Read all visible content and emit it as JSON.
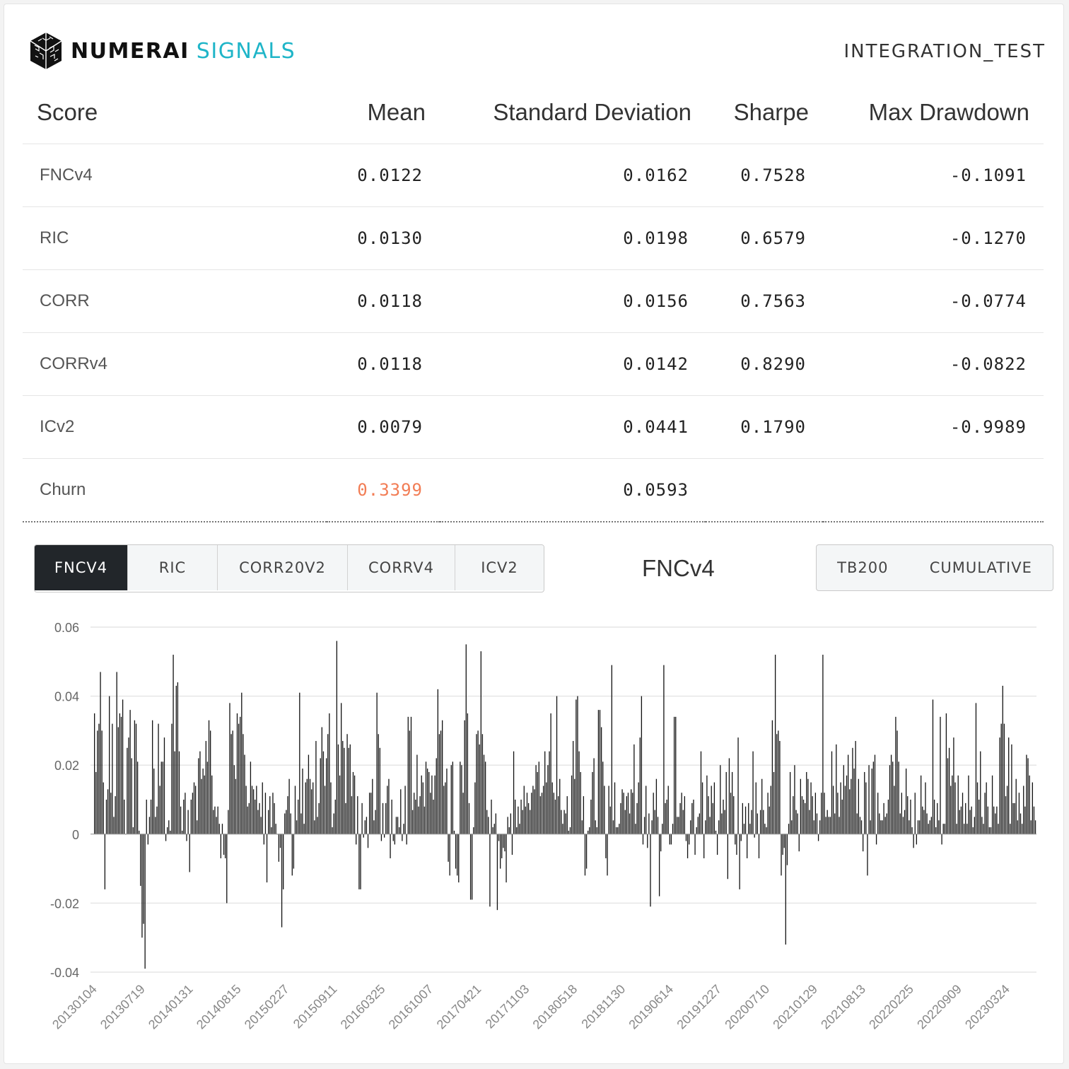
{
  "header": {
    "brand_main": "NUMERAI",
    "brand_sub": "SIGNALS",
    "model_name": "INTEGRATION_TEST"
  },
  "scores_table": {
    "headers": [
      "Score",
      "Mean",
      "Standard Deviation",
      "Sharpe",
      "Max Drawdown"
    ],
    "rows": [
      {
        "name": "FNCv4",
        "mean": "0.0122",
        "std": "0.0162",
        "sharpe": "0.7528",
        "max_drawdown": "-0.1091"
      },
      {
        "name": "RIC",
        "mean": "0.0130",
        "std": "0.0198",
        "sharpe": "0.6579",
        "max_drawdown": "-0.1270"
      },
      {
        "name": "CORR",
        "mean": "0.0118",
        "std": "0.0156",
        "sharpe": "0.7563",
        "max_drawdown": "-0.0774"
      },
      {
        "name": "CORRv4",
        "mean": "0.0118",
        "std": "0.0142",
        "sharpe": "0.8290",
        "max_drawdown": "-0.0822"
      },
      {
        "name": "ICv2",
        "mean": "0.0079",
        "std": "0.0441",
        "sharpe": "0.1790",
        "max_drawdown": "-0.9989"
      },
      {
        "name": "Churn",
        "mean": "0.3399",
        "std": "0.0593",
        "sharpe": "",
        "max_drawdown": ""
      }
    ],
    "highlight_color": "#f27d55"
  },
  "metric_tabs": [
    {
      "label": "FNCV4",
      "active": true
    },
    {
      "label": "RIC",
      "active": false
    },
    {
      "label": "CORR20V2",
      "active": false
    },
    {
      "label": "CORRV4",
      "active": false
    },
    {
      "label": "ICV2",
      "active": false
    }
  ],
  "chart_title": "FNCv4",
  "view_toggles": [
    "TB200",
    "CUMULATIVE"
  ],
  "colors": {
    "accent": "#1fb5c8",
    "active_tab": "#22262a",
    "bar": "#111111",
    "grid": "#e6e6e6"
  },
  "chart_data": {
    "type": "bar",
    "title": "FNCv4",
    "ylim": [
      -0.04,
      0.06
    ],
    "y_ticks": [
      "0.06",
      "0.04",
      "0.02",
      "0",
      "-0.02",
      "-0.04"
    ],
    "y_tick_values": [
      0.06,
      0.04,
      0.02,
      0,
      -0.02,
      -0.04
    ],
    "x_tick_labels": [
      "20130104",
      "20130719",
      "20140131",
      "20140815",
      "20150227",
      "20150911",
      "20160325",
      "20161007",
      "20170421",
      "20171103",
      "20180518",
      "20181130",
      "20190614",
      "20191227",
      "20200710",
      "20210129",
      "20210813",
      "20220225",
      "20220909",
      "20230324"
    ],
    "grid": true,
    "legend": "none",
    "values": [
      0.035,
      0.018,
      0.03,
      0.032,
      0.047,
      0.03,
      0.015,
      -0.016,
      0.01,
      0.013,
      0.04,
      0.012,
      0.032,
      0.005,
      0.011,
      0.047,
      0.031,
      0.035,
      0.034,
      0.039,
      0.01,
      0.0,
      0.025,
      0.028,
      0.036,
      0.022,
      0.002,
      0.033,
      0.032,
      0.021,
      0.001,
      -0.015,
      -0.03,
      -0.026,
      -0.039,
      0.01,
      -0.003,
      0.005,
      0.01,
      0.033,
      0.019,
      0.005,
      0.008,
      0.032,
      0.014,
      0.021,
      0.021,
      0.028,
      -0.002,
      0.002,
      0.004,
      0.001,
      0.032,
      0.052,
      0.024,
      0.043,
      0.044,
      0.024,
      0.008,
      0.001,
      0.01,
      0.012,
      -0.002,
      0.007,
      -0.011,
      0.01,
      0.012,
      0.015,
      0.014,
      0.004,
      0.022,
      0.024,
      0.016,
      0.019,
      0.017,
      0.027,
      0.021,
      0.033,
      0.03,
      0.017,
      0.007,
      0.008,
      0.005,
      0.008,
      0.003,
      -0.007,
      0.003,
      -0.006,
      -0.007,
      -0.02,
      0.007,
      0.038,
      0.029,
      0.03,
      0.02,
      0.016,
      0.035,
      0.032,
      0.034,
      0.041,
      0.029,
      0.023,
      0.014,
      0.008,
      0.009,
      0.021,
      0.014,
      0.013,
      0.01,
      0.014,
      0.007,
      0.009,
      0.005,
      0.015,
      -0.003,
      0.012,
      -0.014,
      0.007,
      0.011,
      0.002,
      0.012,
      0.009,
      0.003,
      0.0,
      -0.008,
      -0.004,
      -0.027,
      -0.016,
      0.006,
      0.007,
      0.011,
      0.016,
      0.006,
      -0.012,
      -0.01,
      0.014,
      0.004,
      0.01,
      0.041,
      0.006,
      0.019,
      0.003,
      0.015,
      0.016,
      0.023,
      0.016,
      0.013,
      0.015,
      0.004,
      0.027,
      0.005,
      0.009,
      0.022,
      0.031,
      0.024,
      0.014,
      0.022,
      0.029,
      0.035,
      0.015,
      0.002,
      0.006,
      0.01,
      0.056,
      0.026,
      0.017,
      0.038,
      0.027,
      0.025,
      0.009,
      0.029,
      0.025,
      0.026,
      0.011,
      0.018,
      0.017,
      -0.003,
      0.011,
      -0.016,
      -0.016,
      0.009,
      -0.001,
      0.004,
      0.005,
      -0.004,
      0.012,
      0.012,
      0.016,
      0.004,
      0.007,
      0.041,
      0.029,
      0.025,
      -0.002,
      0.009,
      -0.001,
      0.009,
      0.014,
      0.016,
      -0.007,
      0.01,
      -0.002,
      -0.003,
      0.005,
      0.005,
      0.002,
      0.013,
      -0.002,
      0.003,
      0.014,
      -0.003,
      0.034,
      0.03,
      0.034,
      0.007,
      0.012,
      0.01,
      0.023,
      0.008,
      0.011,
      0.017,
      0.015,
      0.008,
      0.021,
      0.019,
      0.018,
      0.012,
      0.017,
      0.01,
      0.017,
      0.022,
      0.042,
      0.029,
      0.03,
      0.033,
      0.014,
      0.015,
      0.019,
      -0.008,
      -0.012,
      0.02,
      0.021,
      0.001,
      -0.01,
      -0.012,
      -0.014,
      0.021,
      0.02,
      0.012,
      0.033,
      0.055,
      0.035,
      0.009,
      -0.019,
      -0.019,
      0.002,
      0.015,
      0.029,
      0.03,
      0.026,
      0.053,
      0.029,
      0.023,
      0.021,
      0.007,
      0.005,
      -0.021,
      0.01,
      0.002,
      0.003,
      0.006,
      -0.022,
      -0.002,
      -0.01,
      -0.007,
      -0.004,
      -0.005,
      -0.014,
      0.005,
      0.002,
      0.006,
      -0.006,
      0.024,
      0.01,
      0.002,
      0.008,
      0.003,
      0.01,
      0.007,
      0.014,
      0.008,
      0.012,
      0.009,
      0.007,
      0.012,
      0.014,
      0.013,
      0.02,
      0.018,
      0.021,
      0.011,
      0.012,
      0.014,
      0.024,
      0.015,
      0.02,
      0.024,
      0.035,
      0.015,
      0.012,
      0.01,
      0.04,
      0.011,
      0.016,
      0.007,
      0.003,
      0.007,
      0.006,
      0.011,
      0.001,
      0.002,
      0.017,
      0.027,
      0.016,
      0.039,
      0.04,
      0.024,
      0.018,
      0.004,
      0.011,
      -0.012,
      -0.01,
      0.001,
      0.002,
      0.01,
      0.018,
      0.022,
      0.004,
      0.002,
      0.036,
      0.036,
      0.031,
      0.021,
      0.014,
      -0.007,
      -0.012,
      0.014,
      0.008,
      0.049,
      0.004,
      0.015,
      0.002,
      0.002,
      0.003,
      0.009,
      0.013,
      0.012,
      0.007,
      0.011,
      0.012,
      0.006,
      0.013,
      0.012,
      0.026,
      0.003,
      0.009,
      0.015,
      0.028,
      0.04,
      -0.003,
      0.005,
      0.014,
      -0.004,
      0.006,
      -0.021,
      0.004,
      0.012,
      0.007,
      0.016,
      0.005,
      -0.018,
      -0.005,
      0.003,
      0.049,
      0.009,
      0.01,
      0.014,
      -0.003,
      -0.003,
      0.003,
      0.034,
      0.034,
      0.005,
      0.005,
      0.009,
      0.012,
      0.007,
      0.011,
      -0.002,
      -0.007,
      -0.003,
      0.004,
      0.009,
      0.01,
      -0.006,
      0.002,
      0.005,
      0.006,
      0.024,
      0.015,
      -0.007,
      0.004,
      0.017,
      0.011,
      0.005,
      0.014,
      0.009,
      0.015,
      0.001,
      -0.006,
      0.004,
      0.02,
      0.006,
      0.01,
      0.007,
      0.018,
      -0.013,
      0.022,
      0.012,
      0.018,
      0.011,
      -0.003,
      -0.006,
      0.028,
      -0.016,
      -0.002,
      0.009,
      0.003,
      0.008,
      -0.007,
      0.009,
      0.003,
      0.007,
      0.024,
      -0.001,
      0.015,
      0.006,
      -0.007,
      0.007,
      0.016,
      0.007,
      0.003,
      0.002,
      0.012,
      0.008,
      0.014,
      0.033,
      0.018,
      0.052,
      0.029,
      0.03,
      0.027,
      -0.012,
      -0.006,
      -0.004,
      -0.032,
      -0.009,
      0.003,
      0.018,
      0.004,
      0.011,
      0.02,
      0.007,
      0.006,
      -0.005,
      0.016,
      0.011,
      0.01,
      0.009,
      0.018,
      0.016,
      0.007,
      0.015,
      0.011,
      0.004,
      0.012,
      0.006,
      -0.002,
      0.004,
      0.012,
      0.052,
      0.012,
      0.005,
      0.007,
      0.005,
      0.005,
      0.024,
      0.014,
      0.006,
      0.026,
      0.012,
      0.005,
      0.015,
      0.01,
      0.02,
      0.014,
      0.017,
      0.023,
      0.013,
      0.016,
      0.025,
      0.019,
      0.027,
      0.006,
      0.016,
      0.005,
      0.004,
      -0.005,
      0.018,
      0.015,
      -0.012,
      0.02,
      0.004,
      0.019,
      0.021,
      0.023,
      -0.003,
      0.012,
      0.006,
      0.004,
      0.004,
      0.009,
      0.005,
      0.006,
      0.01,
      0.02,
      0.023,
      0.021,
      0.014,
      0.034,
      0.03,
      0.021,
      0.006,
      0.012,
      0.005,
      0.007,
      0.019,
      0.011,
      0.004,
      0.01,
      0.002,
      -0.004,
      0.012,
      -0.003,
      0.004,
      0.004,
      0.017,
      0.008,
      0.007,
      0.015,
      0.006,
      0.003,
      0.004,
      0.005,
      0.039,
      0.01,
      0.002,
      0.009,
      0.004,
      0.034,
      -0.003,
      0.003,
      0.003,
      0.035,
      0.022,
      0.025,
      0.014,
      0.017,
      0.028,
      0.015,
      0.003,
      0.017,
      0.007,
      0.008,
      0.012,
      0.003,
      0.009,
      0.003,
      0.017,
      0.007,
      0.008,
      0.002,
      0.005,
      0.038,
      0.015,
      0.01,
      0.024,
      0.005,
      0.003,
      0.012,
      0.015,
      0.008,
      0.002,
      0.002,
      0.017,
      0.008,
      0.006,
      0.008,
      0.003,
      0.028,
      0.032,
      0.043,
      0.032,
      0.011,
      0.014,
      0.028,
      0.003,
      0.026,
      0.009,
      0.009,
      0.016,
      0.004,
      0.012,
      0.006,
      0.003,
      0.014,
      0.008,
      0.023,
      0.022,
      0.017,
      0.004,
      0.015,
      0.008,
      0.004
    ]
  }
}
